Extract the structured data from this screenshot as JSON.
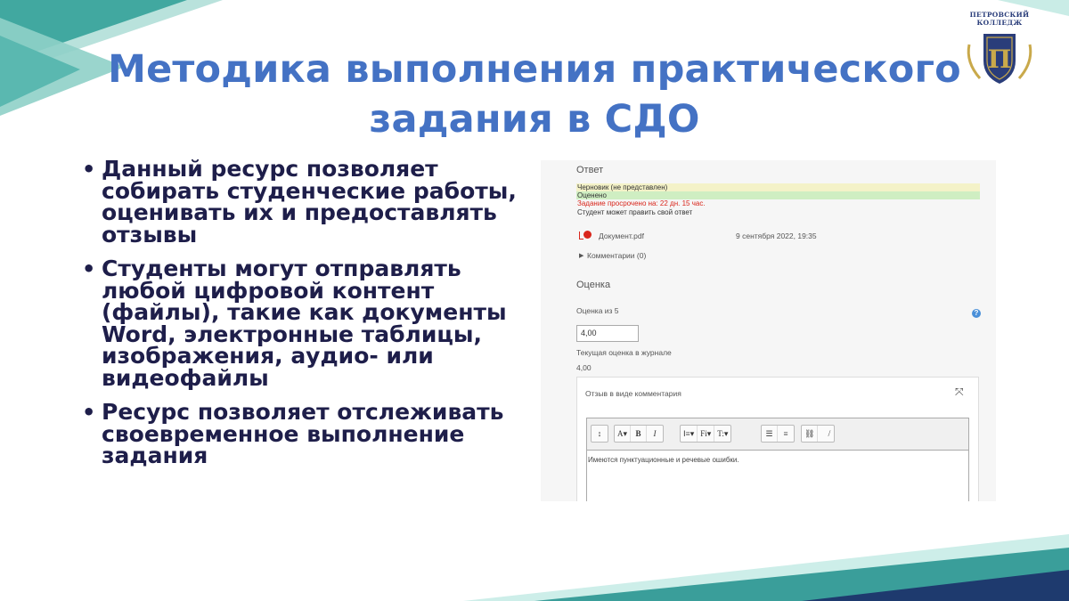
{
  "logo": {
    "line1": "ПЕТРОВСКИЙ",
    "line2": "КОЛЛЕДЖ"
  },
  "title": "Методика выполнения практического задания в СДО",
  "bullets": [
    "Данный ресурс позволяет собирать студенческие работы, оценивать их и предоставлять отзывы",
    "Студенты могут отправлять любой цифровой контент (файлы), такие как документы Word, электронные таблицы, изображения, аудио- или видеофайлы",
    "Ресурс позволяет отслеживать своевременное выполнение задания"
  ],
  "screenshot": {
    "answer_heading": "Ответ",
    "status_draft": "Черновик (не представлен)",
    "status_graded": "Оценено",
    "status_late": "Задание просрочено на: 22 дн. 15 час.",
    "status_edit": "Студент может править свой ответ",
    "file_name": "Документ.pdf",
    "file_date": "9 сентября 2022, 19:35",
    "comments_link": "Комментарии (0)",
    "grade_heading": "Оценка",
    "grade_label": "Оценка из 5",
    "grade_value": "4,00",
    "journal_label": "Текущая оценка в журнале",
    "journal_value": "4,00",
    "feedback_title": "Отзыв в виде комментария",
    "editor_text": "Имеются пунктуационные и речевые ошибки.",
    "toolbar": {
      "g1": [
        "↕"
      ],
      "g2": [
        "A▾",
        "B",
        "I"
      ],
      "g3": [
        "Ⅰ≡▾",
        "Fi▾",
        "T:▾"
      ],
      "g4": [
        "☰",
        "≡"
      ],
      "g5": [
        "⛓",
        "⛓̸"
      ]
    }
  },
  "colors": {
    "title": "#4472c4",
    "bullet_text": "#1e1e4a",
    "teal": "#3a9e9a",
    "navy": "#1e3a6e",
    "late_red": "#d9261c",
    "draft_bg": "#f4f2c8",
    "graded_bg": "#cfeec2"
  }
}
